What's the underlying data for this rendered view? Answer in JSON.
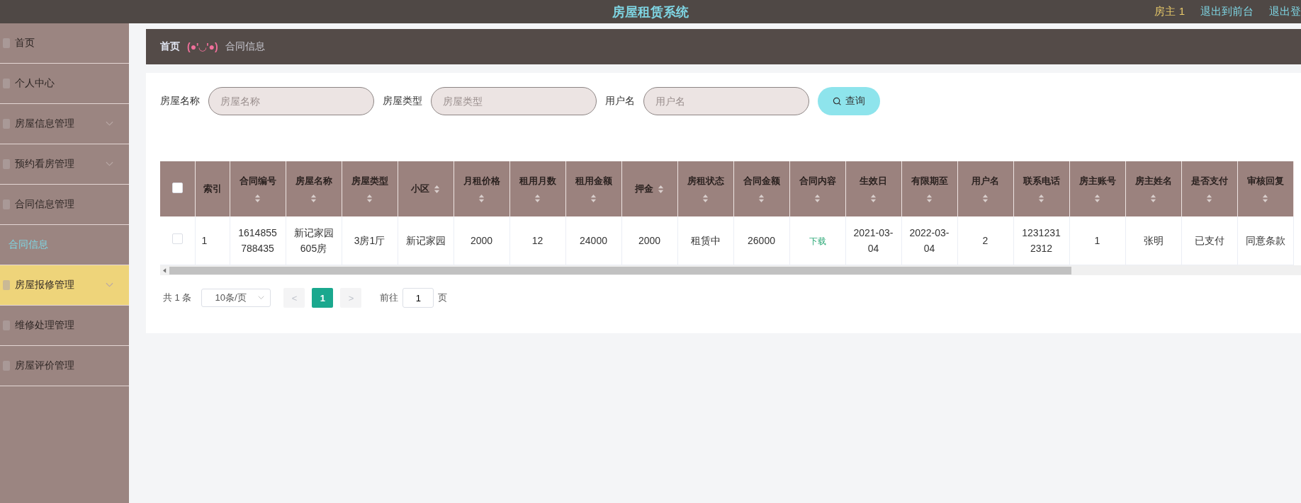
{
  "header": {
    "title": "房屋租赁系统",
    "user": "房主 1",
    "links": [
      "退出到前台",
      "退出登"
    ]
  },
  "sidebar": {
    "items": [
      {
        "label": "首页",
        "hovered": false
      },
      {
        "label": "个人中心",
        "hovered": false
      },
      {
        "label": "房屋信息管理",
        "hovered": false,
        "expanded": false
      },
      {
        "label": "预约看房管理",
        "hovered": false,
        "expanded": false
      },
      {
        "label": "合同信息管理",
        "hovered": false,
        "expanded": true,
        "children": [
          {
            "label": "合同信息",
            "selected": true
          }
        ]
      },
      {
        "label": "房屋报修管理",
        "hovered": true,
        "expanded": false
      },
      {
        "label": "维修处理管理",
        "hovered": false
      },
      {
        "label": "房屋评价管理",
        "hovered": false
      }
    ]
  },
  "breadcrumb": {
    "home": "首页",
    "separator": "(●'◡'●)",
    "current": "合同信息"
  },
  "search": {
    "fields": [
      {
        "label": "房屋名称",
        "placeholder": "房屋名称"
      },
      {
        "label": "房屋类型",
        "placeholder": "房屋类型"
      },
      {
        "label": "用户名",
        "placeholder": "用户名"
      }
    ],
    "button": "查询"
  },
  "table": {
    "select_all_checked": false,
    "columns": [
      {
        "label": "索引",
        "sortable": false,
        "kind": "text"
      },
      {
        "label": "合同编号",
        "sortable": true,
        "kind": "text"
      },
      {
        "label": "房屋名称",
        "sortable": true,
        "kind": "text"
      },
      {
        "label": "房屋类型",
        "sortable": true,
        "kind": "text"
      },
      {
        "label": "小区",
        "sortable": true,
        "kind": "text"
      },
      {
        "label": "月租价格",
        "sortable": true,
        "kind": "text"
      },
      {
        "label": "租用月数",
        "sortable": true,
        "kind": "text"
      },
      {
        "label": "租用金额",
        "sortable": true,
        "kind": "text"
      },
      {
        "label": "押金",
        "sortable": true,
        "kind": "text"
      },
      {
        "label": "房租状态",
        "sortable": true,
        "kind": "text"
      },
      {
        "label": "合同金额",
        "sortable": true,
        "kind": "text"
      },
      {
        "label": "合同内容",
        "sortable": true,
        "kind": "link"
      },
      {
        "label": "生效日",
        "sortable": true,
        "kind": "text"
      },
      {
        "label": "有限期至",
        "sortable": true,
        "kind": "text"
      },
      {
        "label": "用户名",
        "sortable": true,
        "kind": "text"
      },
      {
        "label": "联系电话",
        "sortable": true,
        "kind": "text"
      },
      {
        "label": "房主账号",
        "sortable": true,
        "kind": "text"
      },
      {
        "label": "房主姓名",
        "sortable": true,
        "kind": "text"
      },
      {
        "label": "是否支付",
        "sortable": true,
        "kind": "text"
      },
      {
        "label": "审核回复",
        "sortable": true,
        "kind": "text"
      }
    ],
    "rows": [
      {
        "checked": false,
        "cells": [
          "1",
          "1614855788435",
          "新记家园605房",
          "3房1厅",
          "新记家园",
          "2000",
          "12",
          "24000",
          "2000",
          "租赁中",
          "26000",
          "下载",
          "2021-03-04",
          "2022-03-04",
          "2",
          "12312312312",
          "1",
          "张明",
          "已支付",
          "同意条款"
        ]
      }
    ]
  },
  "pagination": {
    "total": "共 1 条",
    "page_size": "10条/页",
    "prev": "<",
    "next": ">",
    "pages": [
      {
        "label": "1",
        "selected": true
      }
    ],
    "goto_label": "前往",
    "goto_value": "1",
    "goto_suffix": "页"
  }
}
